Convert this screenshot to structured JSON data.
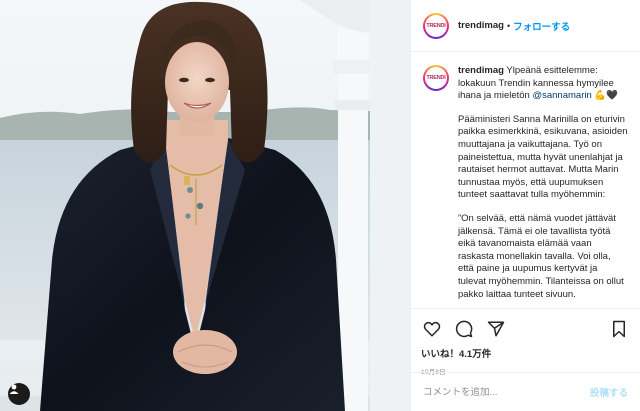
{
  "header": {
    "username": "trendimag",
    "separator": "•",
    "follow_label": "フォローする",
    "avatar_text": "TRENDI"
  },
  "post": {
    "caption_username": "trendimag",
    "caption_text": "Ylpeänä esittelemme: lokakuun Trendin kannessa hymyilee ihana ja mieletön",
    "mention": "@sannamarin",
    "emoji": "💪🖤",
    "paragraph1": "Pääministeri Sanna Marinilla on eturivin paikka esimerkkinä, esikuvana, asioiden muuttajana ja vaikuttajana. Työ on paineistettua, mutta hyvät unenlahjat ja rautaiset hermot auttavat. Mutta Marin tunnustaa myös, että uupumuksen tunteet saattavat tulla myöhemmin:",
    "paragraph2": "”On selvää, että nämä vuodet jättävät jälkensä. Tämä ei ole tavallista työtä eikä tavanomaista elämää vaan raskasta monellakin tavalla. Voi olla, että paine ja uupumus kertyvät ja tulevat myöhemmin. Tilanteissa on ollut pakko laittaa tunteet sivuun."
  },
  "actions": {
    "likes": "いいね！4.1万件",
    "date": "10月8日"
  },
  "comment": {
    "placeholder": "コメントを追加...",
    "post_label": "投稿する"
  },
  "icons": [
    "heart-icon",
    "comment-icon",
    "share-icon",
    "bookmark-icon",
    "user-tag-icon"
  ],
  "colors": {
    "link": "#0095f6",
    "mention": "#00376b",
    "post_disabled": "#b2dffc",
    "muted": "#8e8e8e"
  }
}
